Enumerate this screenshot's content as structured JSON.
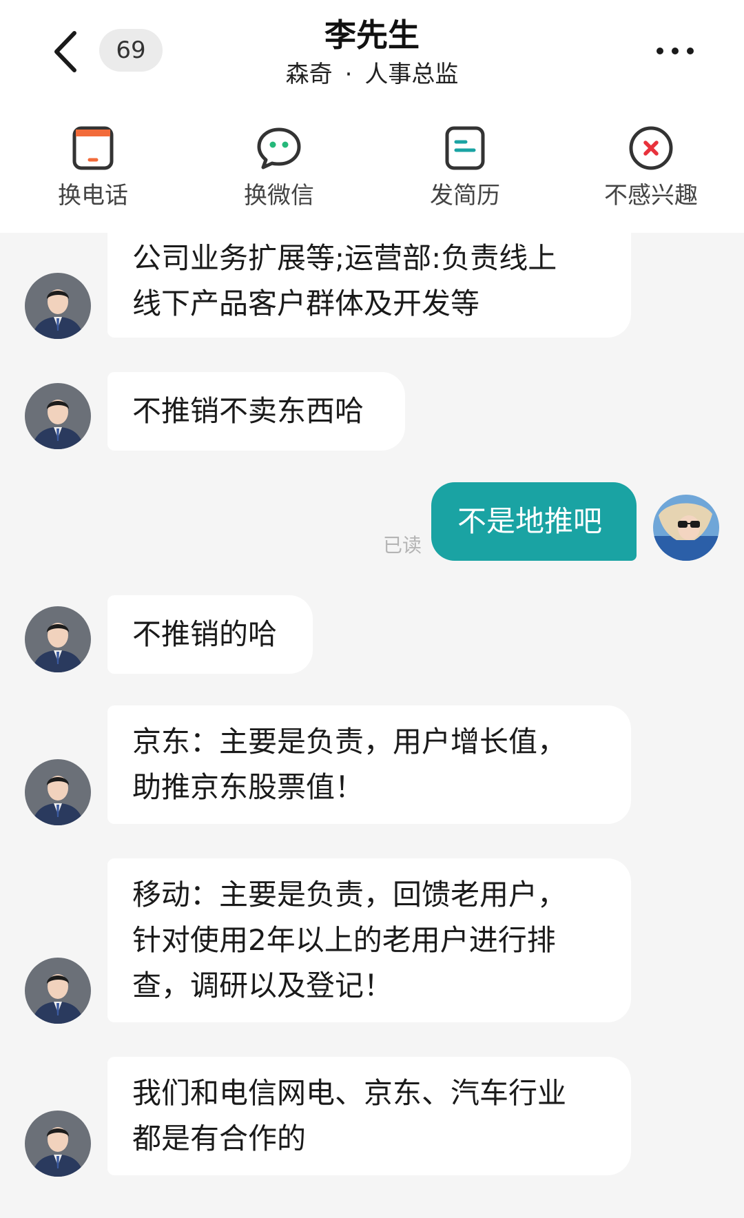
{
  "header": {
    "unread_count": "69",
    "contact_name": "李先生",
    "company": "森奇",
    "separator": "·",
    "job_title": "人事总监"
  },
  "actions": [
    {
      "label": "换电话",
      "icon": "phone-swap-icon"
    },
    {
      "label": "换微信",
      "icon": "wechat-icon"
    },
    {
      "label": "发简历",
      "icon": "resume-icon"
    },
    {
      "label": "不感兴趣",
      "icon": "close-circle-icon"
    }
  ],
  "colors": {
    "accent": "#1aa3a3",
    "icon_orange": "#f26b3a",
    "icon_green": "#25b87a",
    "icon_teal": "#1aa3a3",
    "icon_red": "#e8323c"
  },
  "messages": [
    {
      "sender": "them",
      "lines": [
        "公司业务扩展等;运营部:负责线上",
        "线下产品客户群体及开发等"
      ]
    },
    {
      "sender": "them",
      "lines": [
        "不推销不卖东西哈"
      ]
    },
    {
      "sender": "me",
      "lines": [
        "不是地推吧"
      ],
      "status": "已读"
    },
    {
      "sender": "them",
      "lines": [
        "不推销的哈"
      ]
    },
    {
      "sender": "them",
      "lines": [
        "京东：主要是负责，用户增长值，",
        "助推京东股票值！"
      ]
    },
    {
      "sender": "them",
      "lines": [
        "移动：主要是负责，回馈老用户，",
        "针对使用2年以上的老用户进行排",
        "查，调研以及登记！"
      ]
    },
    {
      "sender": "them",
      "lines": [
        "我们和电信网电、京东、汽车行业",
        "都是有合作的"
      ]
    }
  ]
}
